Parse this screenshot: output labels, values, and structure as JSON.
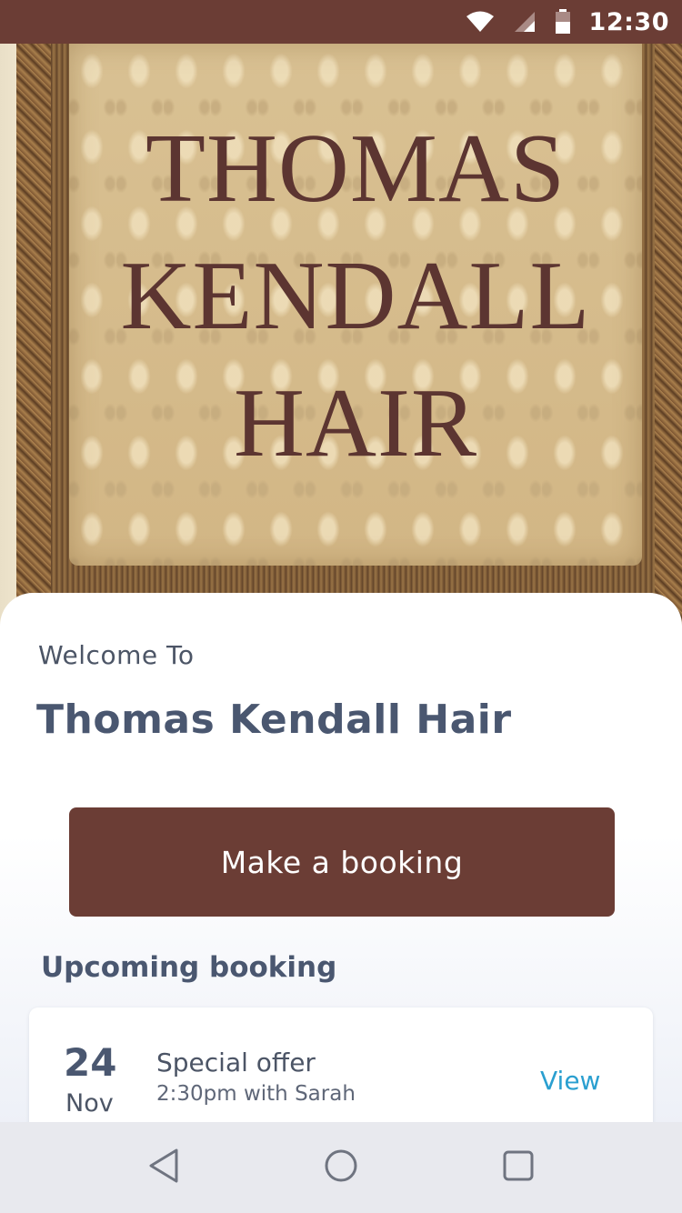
{
  "status_bar": {
    "time": "12:30",
    "icons": [
      "wifi-icon",
      "signal-icon",
      "battery-icon"
    ]
  },
  "hero": {
    "sign_lines": [
      "THOMAS",
      "KENDALL",
      "HAIR"
    ]
  },
  "home": {
    "welcome_text": "Welcome To",
    "salon_name": "Thomas Kendall Hair",
    "booking_button_label": "Make a booking",
    "upcoming_title": "Upcoming booking"
  },
  "upcoming_booking": {
    "day": "24",
    "month": "Nov",
    "title": "Special offer",
    "detail": "2:30pm with Sarah",
    "action_label": "View"
  },
  "nav_bar": {
    "icons": [
      "back-icon",
      "home-icon",
      "recents-icon"
    ]
  },
  "colors": {
    "brand": "#6b3d35",
    "heading": "#4a5770",
    "link": "#2a9fd0"
  }
}
